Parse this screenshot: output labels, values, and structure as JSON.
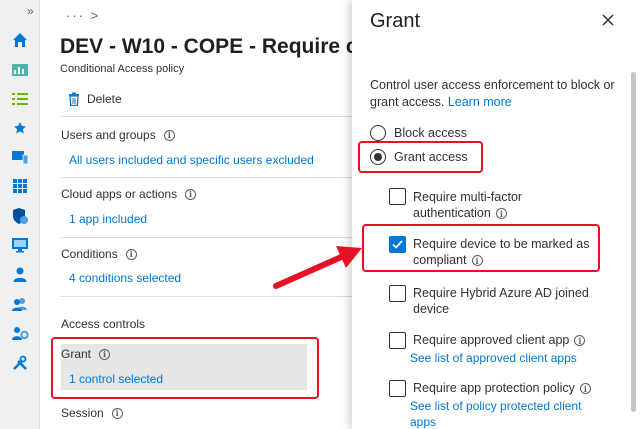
{
  "rail": {
    "expand": "»",
    "icons": [
      "home-icon",
      "dashboard-icon",
      "all-services-icon",
      "favorites-star-icon",
      "devices-icon",
      "apps-grid-icon",
      "endpoint-security-icon",
      "reports-icon",
      "users-icon",
      "groups-icon",
      "tenant-admin-icon",
      "troubleshooting-icon"
    ]
  },
  "main": {
    "breadcrumb": "··· >",
    "title": "DEV - W10 - COPE - Require c",
    "subtitle": "Conditional Access policy",
    "delete_label": "Delete",
    "sections": {
      "users_label": "Users and groups",
      "users_value": "All users included and specific users excluded",
      "apps_label": "Cloud apps or actions",
      "apps_value": "1 app included",
      "conditions_label": "Conditions",
      "conditions_value": "4 conditions selected",
      "access_controls_label": "Access controls",
      "grant_label": "Grant",
      "grant_value": "1 control selected",
      "session_label": "Session"
    }
  },
  "panel": {
    "title": "Grant",
    "close": "×",
    "description": "Control user access enforcement to block or grant access.",
    "learn_more": "Learn more",
    "block_access": "Block access",
    "grant_access": "Grant access",
    "options": {
      "mfa_line1": "Require multi-factor",
      "mfa_line2": "authentication",
      "compliant_line1": "Require device to be marked as",
      "compliant_line2": "compliant",
      "hybrid_line1": "Require Hybrid Azure AD joined",
      "hybrid_line2": "device",
      "approved_app": "Require approved client app",
      "approved_app_link": "See list of approved client apps",
      "app_protection": "Require app protection policy",
      "app_protection_link_line1": "See list of policy protected client",
      "app_protection_link_line2": "apps"
    },
    "states": {
      "block_access_selected": false,
      "grant_access_selected": true,
      "mfa_checked": false,
      "compliant_checked": true,
      "hybrid_checked": false,
      "approved_app_checked": false,
      "app_protection_checked": false
    }
  },
  "colors": {
    "accent": "#0078d4",
    "highlight_red": "#e81123",
    "selected_row": "#e6e6e6"
  }
}
